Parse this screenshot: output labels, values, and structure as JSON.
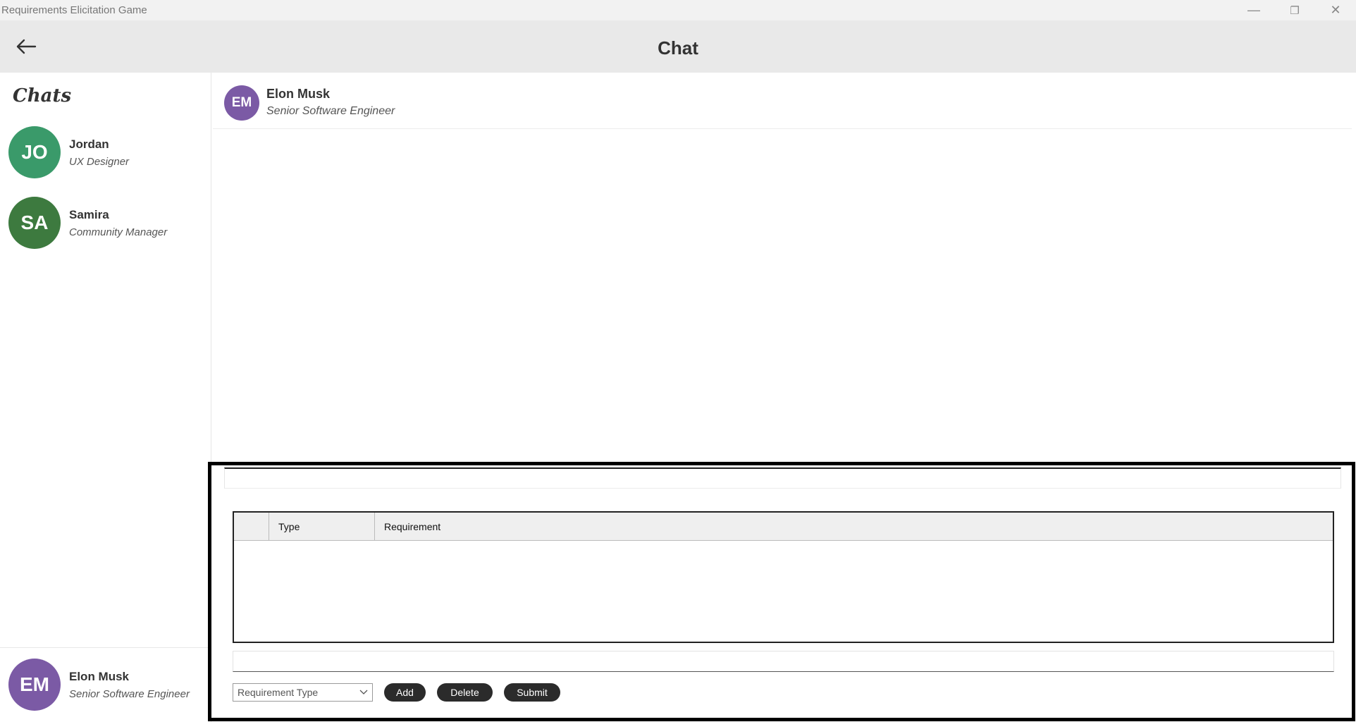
{
  "window": {
    "title": "Requirements Elicitation Game",
    "controls": {
      "minimize": "—",
      "maximize": "❐",
      "close": "✕"
    }
  },
  "header": {
    "title": "Chat"
  },
  "sidebar": {
    "heading": "Chats",
    "contacts": [
      {
        "initials": "JO",
        "name": "Jordan",
        "role": "UX Designer",
        "color": "#3a9a6a"
      },
      {
        "initials": "SA",
        "name": "Samira",
        "role": "Community Manager",
        "color": "#3d7a3f"
      }
    ],
    "current_user": {
      "initials": "EM",
      "name": "Elon Musk",
      "role": "Senior Software Engineer",
      "color": "#7b5aa5"
    }
  },
  "chat": {
    "participant": {
      "initials": "EM",
      "name": "Elon Musk",
      "role": "Senior Software Engineer",
      "color": "#7b5aa5"
    },
    "message_input": {
      "value": "",
      "placeholder": ""
    }
  },
  "requirements": {
    "columns": [
      "",
      "Type",
      "Requirement"
    ],
    "rows": [],
    "input": {
      "value": "",
      "placeholder": ""
    },
    "type_select": {
      "selected": "Requirement Type"
    },
    "buttons": {
      "add": "Add",
      "delete": "Delete",
      "submit": "Submit"
    }
  }
}
